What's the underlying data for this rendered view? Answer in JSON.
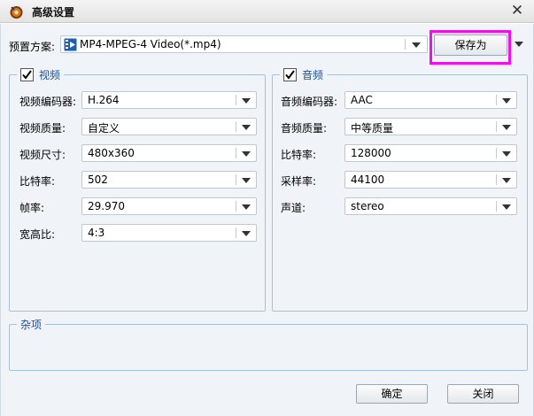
{
  "window": {
    "title": "高级设置",
    "close_glyph": "✕"
  },
  "preset": {
    "label": "预置方案:",
    "value": "MP4-MPEG-4 Video(*.mp4)",
    "save_as_label": "保存为"
  },
  "video": {
    "title": "视频",
    "checked": true,
    "rows": [
      {
        "label": "视频编码器:",
        "value": "H.264"
      },
      {
        "label": "视频质量:",
        "value": "自定义"
      },
      {
        "label": "视频尺寸:",
        "value": "480x360"
      },
      {
        "label": "比特率:",
        "value": "502"
      },
      {
        "label": "帧率:",
        "value": "29.970"
      },
      {
        "label": "宽高比:",
        "value": "4:3"
      }
    ]
  },
  "audio": {
    "title": "音频",
    "checked": true,
    "rows": [
      {
        "label": "音频编码器:",
        "value": "AAC"
      },
      {
        "label": "音频质量:",
        "value": "中等质量"
      },
      {
        "label": "比特率:",
        "value": "128000"
      },
      {
        "label": "采样率:",
        "value": "44100"
      },
      {
        "label": "声道:",
        "value": "stereo"
      }
    ]
  },
  "misc": {
    "title": "杂项"
  },
  "footer": {
    "ok_label": "确定",
    "close_label": "关闭"
  },
  "colors": {
    "highlight": "#ee10e8",
    "group_title": "#1a4f9c"
  }
}
